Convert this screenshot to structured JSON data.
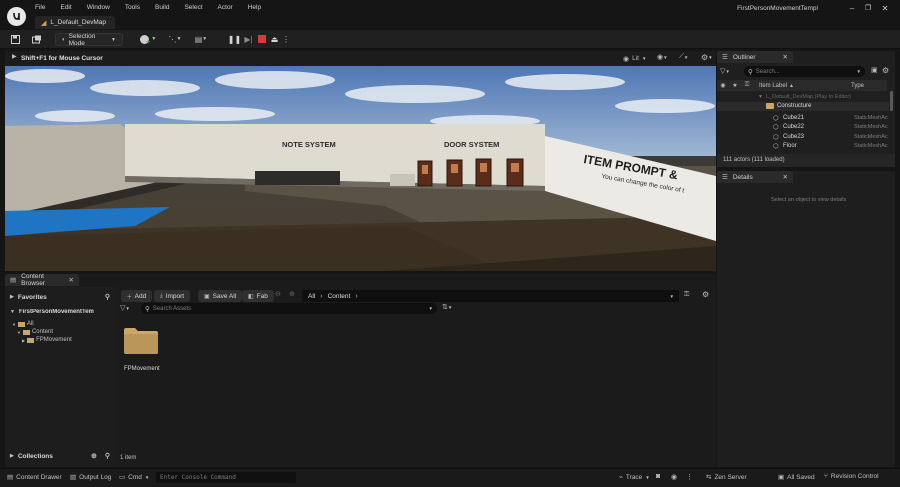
{
  "menu": [
    "File",
    "Edit",
    "Window",
    "Tools",
    "Build",
    "Select",
    "Actor",
    "Help"
  ],
  "document_tab": "L_Default_DevMap",
  "window_title": "FirstPersonMovementTempl",
  "toolbar": {
    "selection_mode": "Selection Mode"
  },
  "viewport": {
    "hint": "Shift+F1 for Mouse Cursor",
    "lit_label": "Lit",
    "scene_text": {
      "note_system": "NOTE SYSTEM",
      "door_system": "DOOR SYSTEM",
      "item_prompt": "ITEM PROMPT &",
      "item_prompt_sub": "You can change the color of t"
    }
  },
  "outliner": {
    "title": "Outliner",
    "search_placeholder": "Search...",
    "col_label": "Item Label",
    "col_type": "Type",
    "rows": [
      {
        "label": "L_Default_DevMap (Play In Editor)",
        "type": ""
      },
      {
        "label": "Constructure",
        "type": ""
      },
      {
        "label": "Cube21",
        "type": "StaticMeshAc"
      },
      {
        "label": "Cube22",
        "type": "StaticMeshAc"
      },
      {
        "label": "Cube23",
        "type": "StaticMeshAc"
      },
      {
        "label": "Floor",
        "type": "StaticMeshAc"
      }
    ],
    "footer": "111 actors (111 loaded)"
  },
  "details": {
    "title": "Details",
    "empty_text": "Select an object to view details"
  },
  "content_browser": {
    "title": "Content Browser",
    "favorites": "Favorites",
    "project": "FirstPersonMovementTem",
    "tree": [
      "All",
      "Content",
      "FPMovement"
    ],
    "collections": "Collections",
    "add": "Add",
    "import": "Import",
    "save_all": "Save All",
    "fab": "Fab",
    "path": [
      "All",
      "Content"
    ],
    "search_placeholder": "Search Assets",
    "folder_name": "FPMovement",
    "item_count": "1 item"
  },
  "statusbar": {
    "content_drawer": "Content Drawer",
    "output_log": "Output Log",
    "cmd": "Cmd",
    "console_placeholder": "Enter Console Command",
    "trace": "Trace",
    "zen_server": "Zen Server",
    "all_saved": "All Saved",
    "revision_control": "Revision Control"
  },
  "colors": {
    "folder": "#c9a669",
    "accent": "#2f7ad8",
    "stop": "#d83a3a",
    "bg": "#151515"
  }
}
